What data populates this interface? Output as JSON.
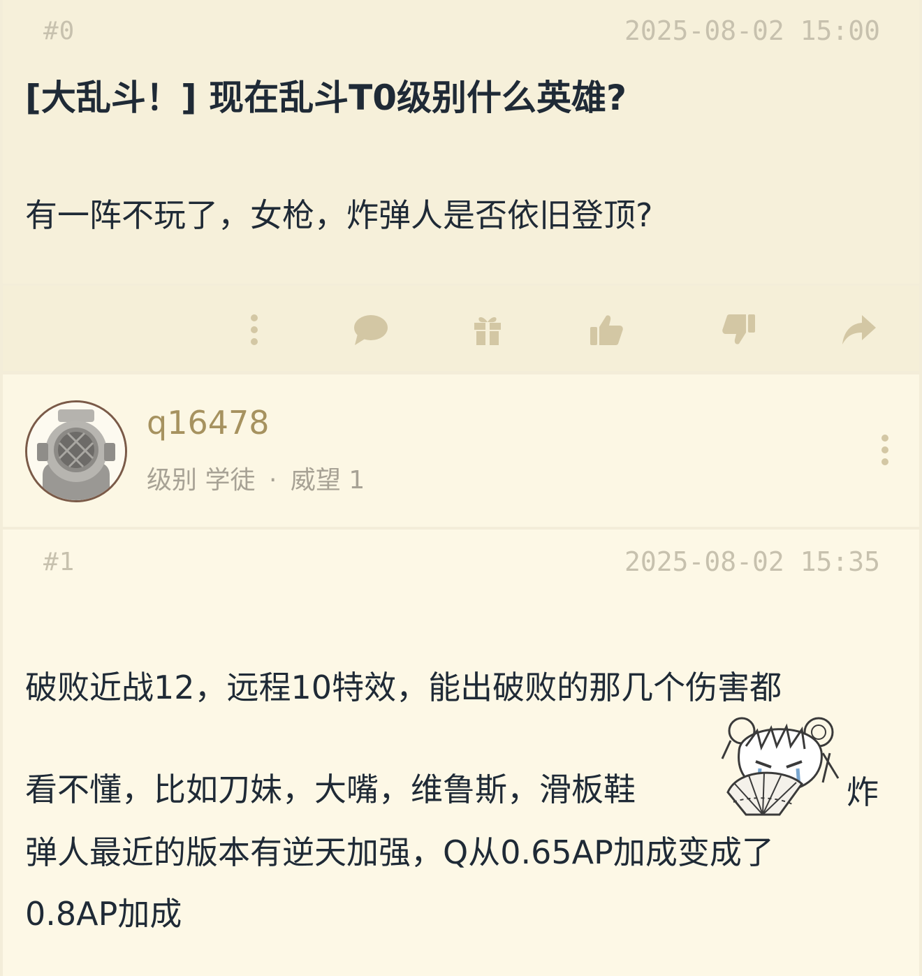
{
  "post0": {
    "floor": "#0",
    "time": "2025-08-02 15:00",
    "title": "[大乱斗！] 现在乱斗T0级别什么英雄?",
    "body": "有一阵不玩了，女枪，炸弹人是否依旧登顶?"
  },
  "actions": [
    {
      "name": "more",
      "icon": "vertical-ellipsis-icon"
    },
    {
      "name": "comment",
      "icon": "speech-bubble-icon"
    },
    {
      "name": "gift",
      "icon": "gift-icon"
    },
    {
      "name": "upvote",
      "icon": "thumbs-up-icon"
    },
    {
      "name": "downvote",
      "icon": "thumbs-down-icon"
    },
    {
      "name": "share",
      "icon": "share-arrow-icon"
    }
  ],
  "user": {
    "avatar_icon": "diving-helmet-icon",
    "name": "q16478",
    "level_label": "级别",
    "level_value": "学徒",
    "separator": "·",
    "prestige_label": "威望",
    "prestige_value": "1"
  },
  "post1": {
    "floor": "#1",
    "time": "2025-08-02 15:35",
    "lines": [
      "破败近战12，远程10特效，能出破败的那几个伤害都",
      "看不懂，比如刀妹，大嘴，维鲁斯，滑板鞋",
      "弹人最近的版本有逆天加强，Q从0.65AP加成变成了",
      "0.8AP加成"
    ],
    "line2_tail": "炸",
    "sticker_icon": "anime-girl-fan-sticker"
  },
  "colors": {
    "post0_bg": "#f6f0da",
    "action_bar_bg": "#f5efd8",
    "user_row_bg": "#fcf7e4",
    "post1_bg": "#fdf8e6",
    "username": "#a6925f",
    "icon": "#d3c7a4",
    "text": "#1f2a36",
    "meta": "#c7c1ae"
  }
}
